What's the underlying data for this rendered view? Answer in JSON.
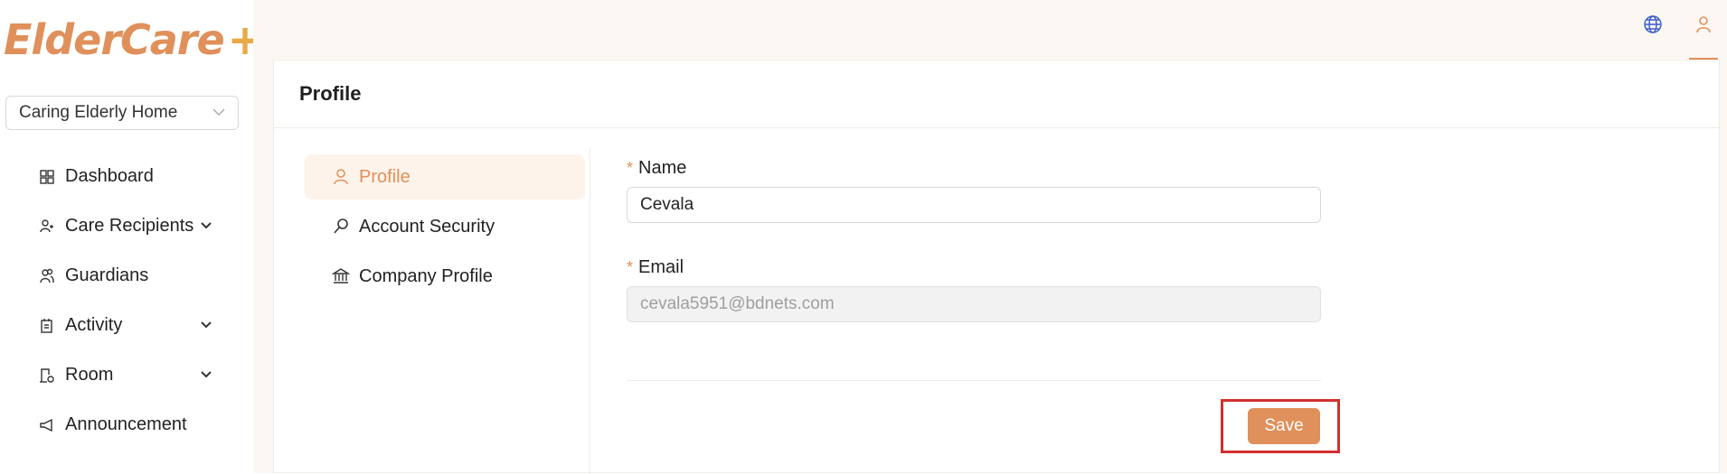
{
  "app": {
    "logo_text": "ElderCare",
    "logo_plus": "+"
  },
  "org_selector": {
    "value": "Caring Elderly Home"
  },
  "sidebar": {
    "items": [
      {
        "label": "Dashboard",
        "icon": "dashboard-icon",
        "expandable": false
      },
      {
        "label": "Care Recipients",
        "icon": "care-recipients-icon",
        "expandable": true
      },
      {
        "label": "Guardians",
        "icon": "guardians-icon",
        "expandable": false
      },
      {
        "label": "Activity",
        "icon": "activity-icon",
        "expandable": true
      },
      {
        "label": "Room",
        "icon": "room-icon",
        "expandable": true
      },
      {
        "label": "Announcement",
        "icon": "announcement-icon",
        "expandable": false
      }
    ]
  },
  "topbar": {
    "icons": [
      "globe-icon",
      "user-icon"
    ]
  },
  "page": {
    "title": "Profile",
    "tabs": [
      {
        "label": "Profile",
        "icon": "user-icon",
        "active": true
      },
      {
        "label": "Account Security",
        "icon": "key-icon",
        "active": false
      },
      {
        "label": "Company Profile",
        "icon": "bank-icon",
        "active": false
      }
    ],
    "form": {
      "name_label": "Name",
      "name_value": "Cevala",
      "email_label": "Email",
      "email_value": "cevala5951@bdnets.com",
      "required_marker": "*"
    },
    "save_label": "Save"
  },
  "colors": {
    "accent": "#e0905a",
    "highlight_border": "#d32f2f"
  }
}
